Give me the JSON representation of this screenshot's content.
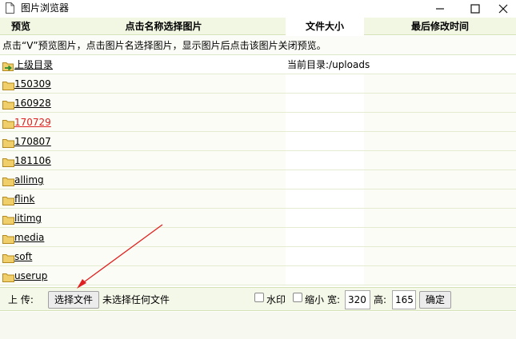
{
  "window": {
    "title": "图片浏览器",
    "icons": [
      "file-icon",
      "minimize-icon",
      "maximize-icon",
      "close-icon"
    ]
  },
  "columns": {
    "preview": "预览",
    "name": "点击名称选择图片",
    "size": "文件大小",
    "modified": "最后修改时间"
  },
  "hint": "点击“V”预览图片，点击图片名选择图片，显示图片后点击该图片关闭预览。",
  "parent": {
    "label": "上级目录",
    "current_dir": "当前目录:/uploads"
  },
  "folders": [
    {
      "name": "150309",
      "visited": false
    },
    {
      "name": "160928",
      "visited": false
    },
    {
      "name": "170729",
      "visited": true
    },
    {
      "name": "170807",
      "visited": false
    },
    {
      "name": "181106",
      "visited": false
    },
    {
      "name": "allimg",
      "visited": false
    },
    {
      "name": "flink",
      "visited": false
    },
    {
      "name": "litimg",
      "visited": false
    },
    {
      "name": "media",
      "visited": false
    },
    {
      "name": "soft",
      "visited": false
    },
    {
      "name": "userup",
      "visited": false
    }
  ],
  "upload": {
    "label": "上 传:",
    "choose_file": "选择文件",
    "no_file": "未选择任何文件",
    "watermark": "水印",
    "thumbnail": "缩小",
    "width_label": "宽:",
    "width_value": "320",
    "height_label": "高:",
    "height_value": "165",
    "confirm": "确定"
  },
  "colors": {
    "header_bg": "#f1f7e3",
    "visited_link": "#dd2222",
    "annotation_arrow": "#e02020"
  }
}
